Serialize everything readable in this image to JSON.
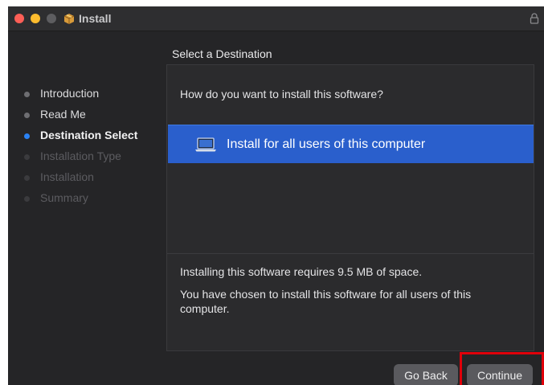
{
  "window": {
    "title": "Install"
  },
  "sidebar": {
    "steps": [
      {
        "label": "Introduction",
        "state": "done"
      },
      {
        "label": "Read Me",
        "state": "done"
      },
      {
        "label": "Destination Select",
        "state": "current"
      },
      {
        "label": "Installation Type",
        "state": "future"
      },
      {
        "label": "Installation",
        "state": "future"
      },
      {
        "label": "Summary",
        "state": "future"
      }
    ]
  },
  "main": {
    "section_title": "Select a Destination",
    "question": "How do you want to install this software?",
    "option_label": "Install for all users of this computer",
    "info_space": "Installing this software requires 9.5 MB of space.",
    "info_users": "You have chosen to install this software for all users of this computer."
  },
  "buttons": {
    "go_back": "Go Back",
    "continue": "Continue"
  },
  "colors": {
    "accent": "#2a82f4",
    "selection": "#2a5fcc",
    "highlight_box": "#e0000a",
    "close": "#fe5f57",
    "minimize": "#febc2e"
  },
  "icons": {
    "app": "package-icon",
    "lock": "lock-icon",
    "option": "laptop-icon"
  }
}
